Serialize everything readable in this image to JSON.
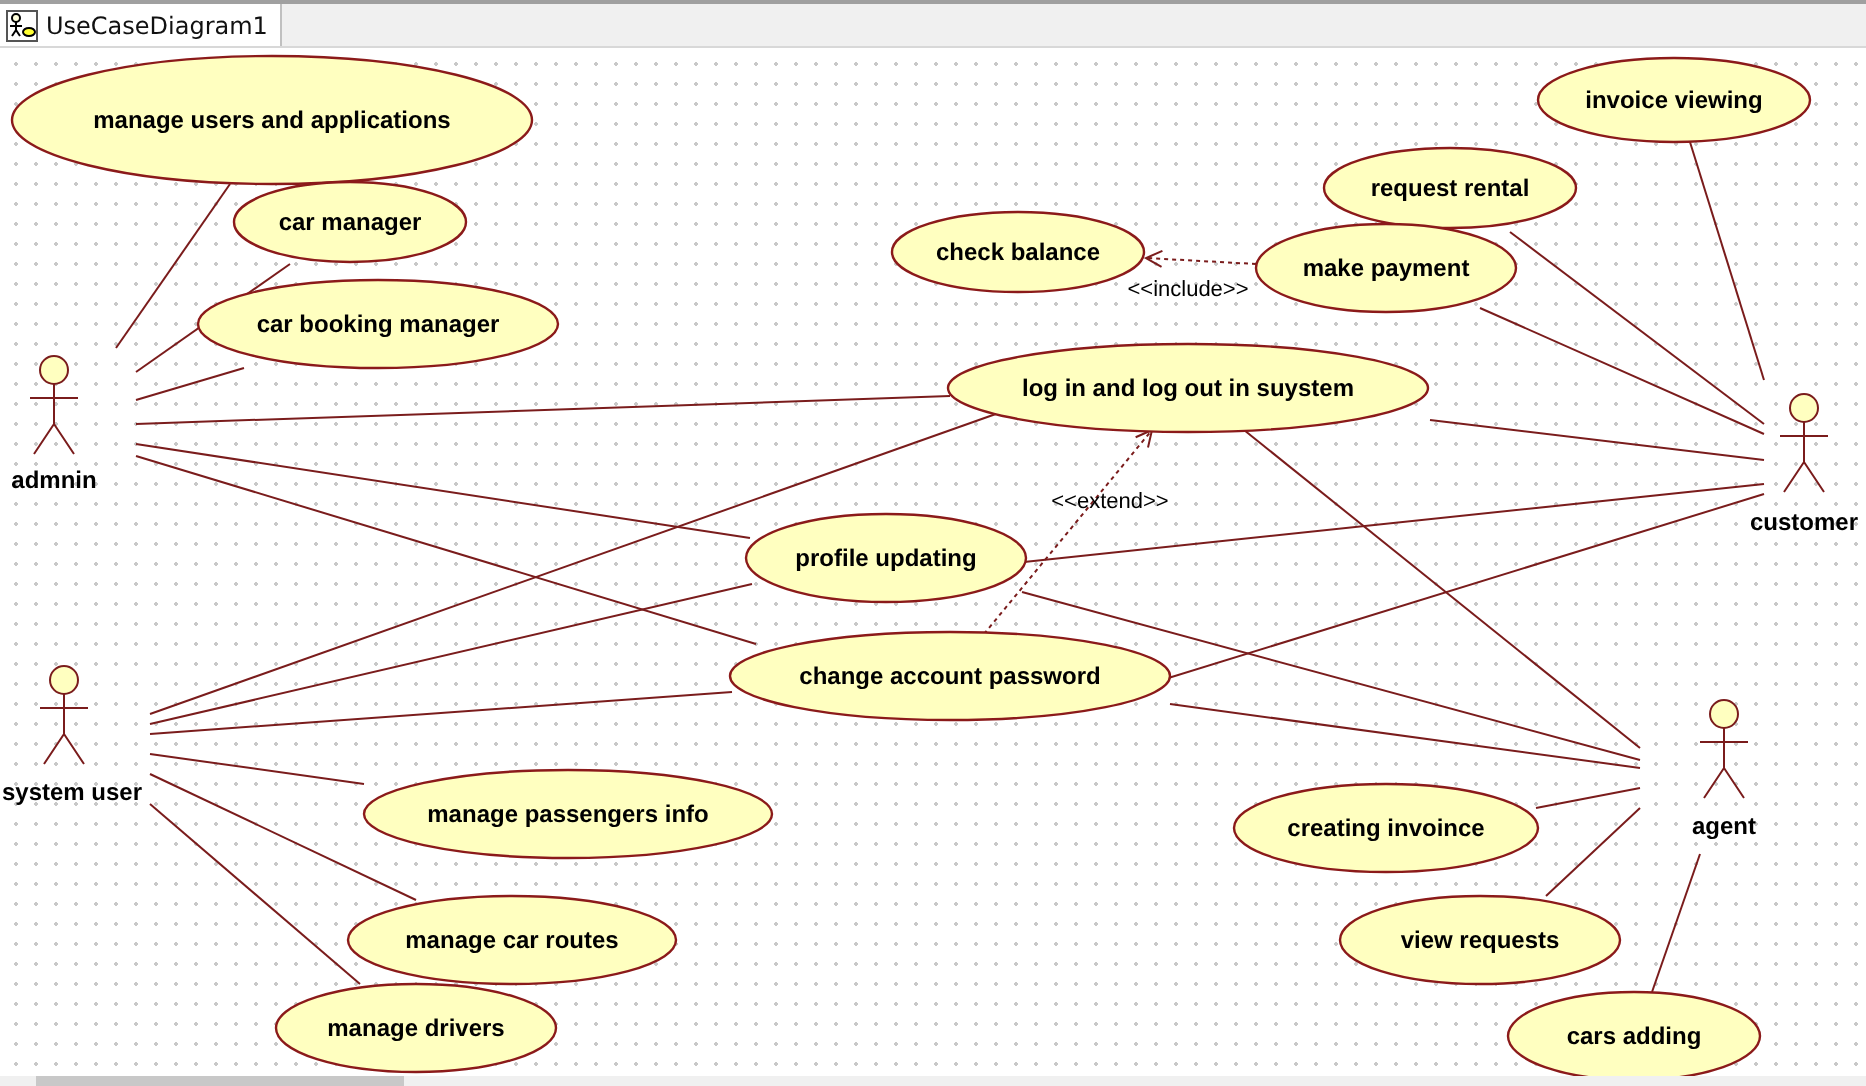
{
  "tab": {
    "title": "UseCaseDiagram1",
    "selected": true
  },
  "actors": [
    {
      "name": "admnin"
    },
    {
      "name": "customer"
    },
    {
      "name": "system user"
    },
    {
      "name": "agent"
    }
  ],
  "use_cases": [
    {
      "name": "manage users and applications"
    },
    {
      "name": "car manager"
    },
    {
      "name": "car booking manager"
    },
    {
      "name": "check balance"
    },
    {
      "name": "request rental"
    },
    {
      "name": "make payment"
    },
    {
      "name": "invoice viewing"
    },
    {
      "name": "log in and log out in suystem"
    },
    {
      "name": "profile updating"
    },
    {
      "name": "change account password"
    },
    {
      "name": "manage passengers info"
    },
    {
      "name": "manage car routes"
    },
    {
      "name": "manage drivers"
    },
    {
      "name": "creating invoince"
    },
    {
      "name": "view requests"
    },
    {
      "name": "cars adding"
    }
  ],
  "relationships": [
    {
      "kind": "include",
      "label": "<<include>>"
    },
    {
      "kind": "extend",
      "label": "<<extend>>"
    }
  ]
}
